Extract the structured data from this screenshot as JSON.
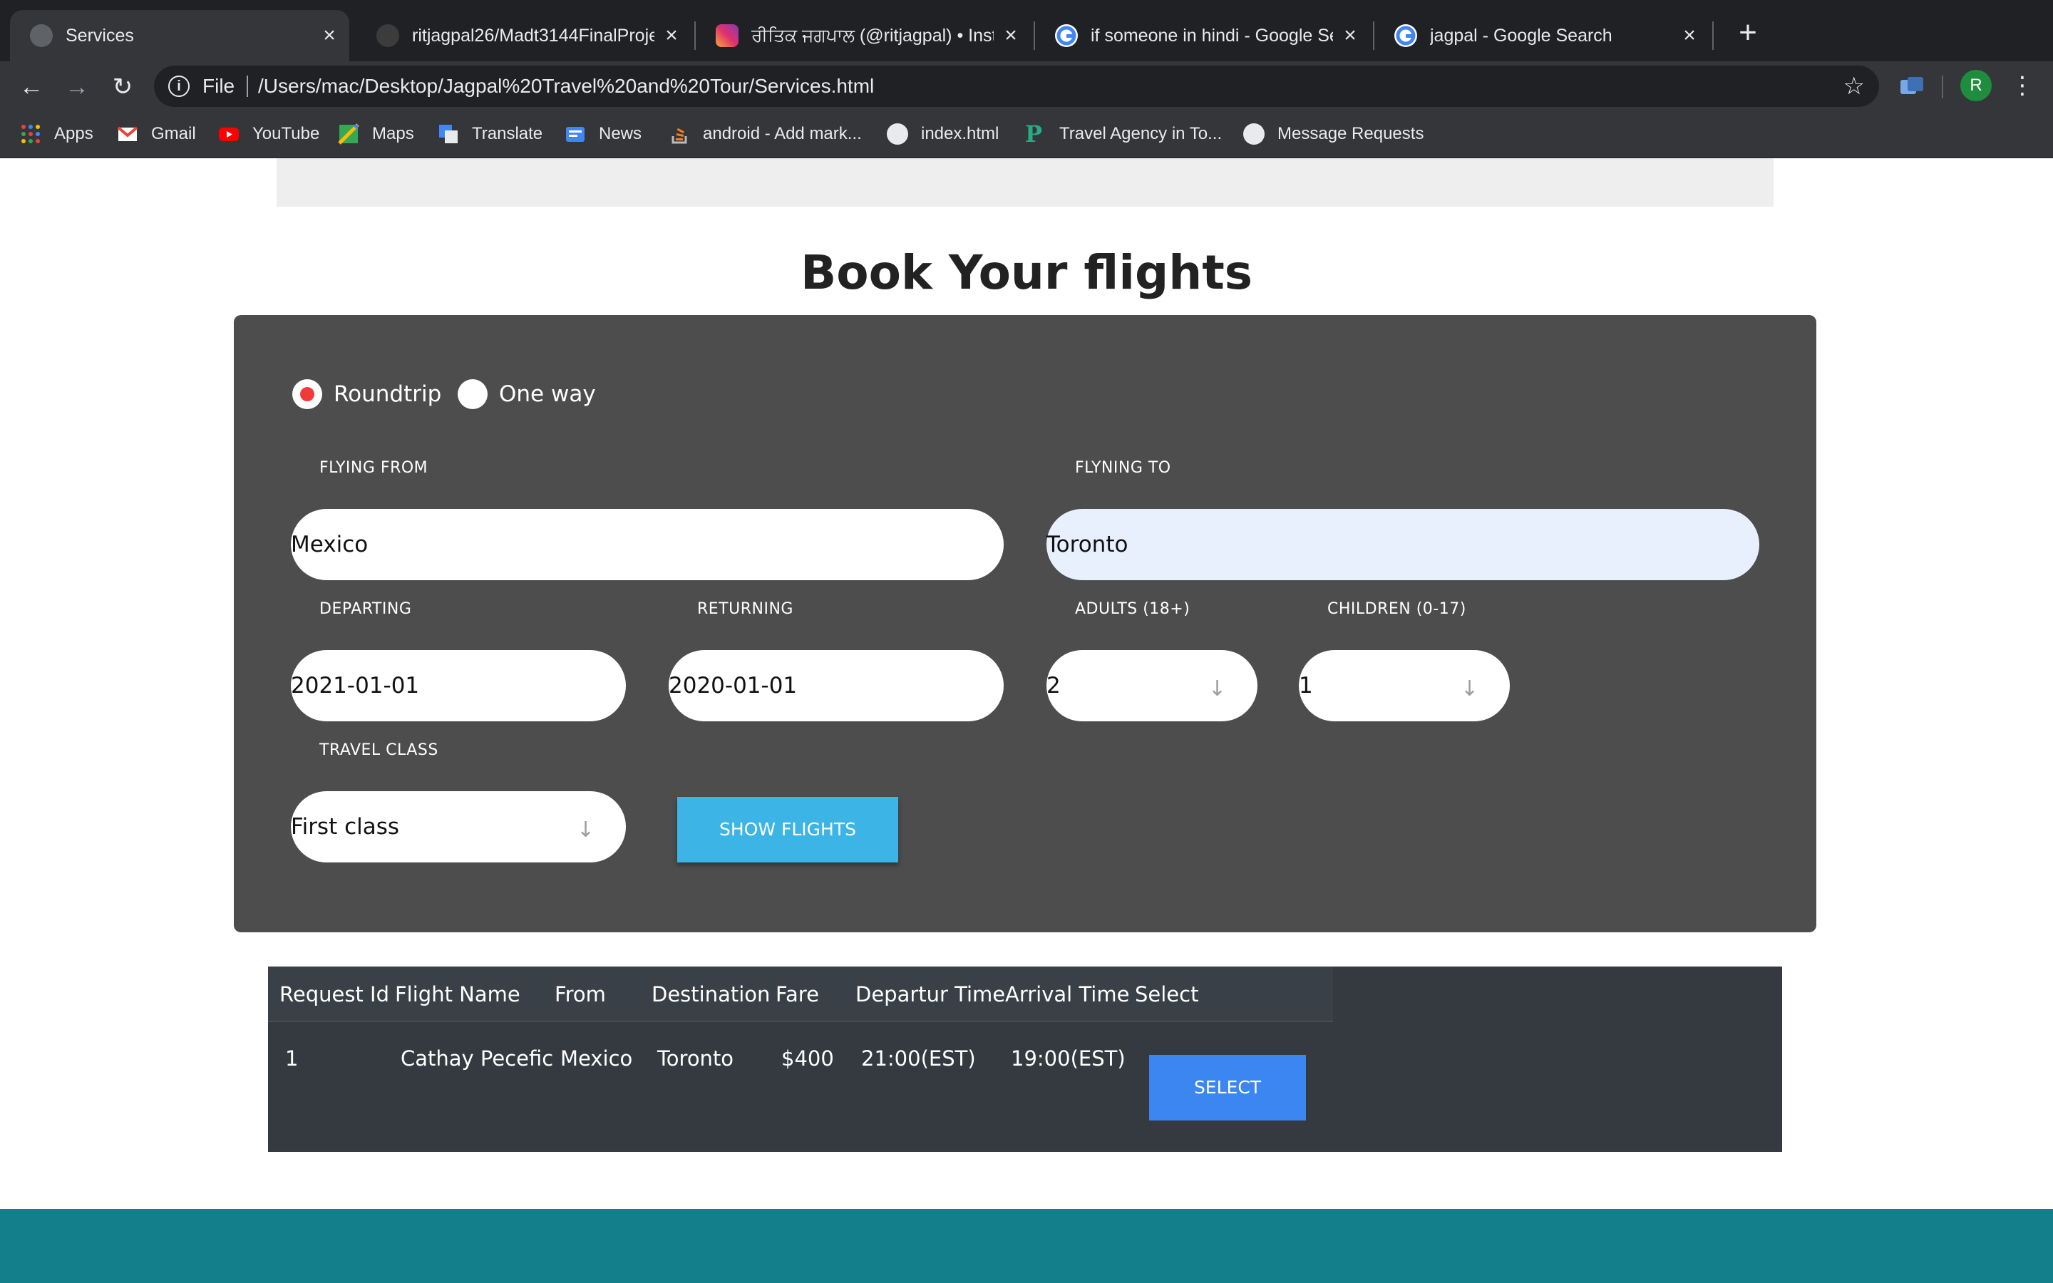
{
  "browser": {
    "tabs": [
      {
        "title": "Services",
        "icon": "globe-icon"
      },
      {
        "title": "ritjagpal26/Madt3144FinalProjec",
        "icon": "github-icon"
      },
      {
        "title": "ਰੀਤਿਕ ਜਗਪਾਲ (@ritjagpal) • Instagr",
        "icon": "instagram-icon"
      },
      {
        "title": "if someone in hindi - Google Sea",
        "icon": "google-icon"
      },
      {
        "title": "jagpal - Google Search",
        "icon": "google-icon"
      }
    ],
    "address": {
      "scheme": "File",
      "url": "/Users/mac/Desktop/Jagpal%20Travel%20and%20Tour/Services.html"
    },
    "profile_initial": "R",
    "bookmarks": [
      {
        "label": "Apps",
        "icon": "apps-grid-icon"
      },
      {
        "label": "Gmail",
        "icon": "gmail-icon"
      },
      {
        "label": "YouTube",
        "icon": "youtube-icon"
      },
      {
        "label": "Maps",
        "icon": "maps-icon"
      },
      {
        "label": "Translate",
        "icon": "translate-icon"
      },
      {
        "label": "News",
        "icon": "news-icon"
      },
      {
        "label": "android - Add mark...",
        "icon": "stackoverflow-icon"
      },
      {
        "label": "index.html",
        "icon": "globe-icon"
      },
      {
        "label": "Travel Agency in To...",
        "icon": "p-logo-icon"
      },
      {
        "label": "Message Requests",
        "icon": "globe-icon"
      }
    ]
  },
  "page": {
    "title": "Book Your flights",
    "trip_type": {
      "options": [
        "Roundtrip",
        "One way"
      ],
      "selected": "Roundtrip"
    },
    "form": {
      "flying_from_label": "FLYING FROM",
      "flying_from_value": "Mexico",
      "flying_to_label": "FLYNING TO",
      "flying_to_value": "Toronto",
      "departing_label": "DEPARTING",
      "departing_value": "2021-01-01",
      "returning_label": "RETURNING",
      "returning_value": "2020-01-01",
      "adults_label": "ADULTS (18+)",
      "adults_value": "2",
      "children_label": "CHILDREN (0-17)",
      "children_value": "1",
      "travel_class_label": "TRAVEL CLASS",
      "travel_class_value": "First class",
      "submit_label": "SHOW FLIGHTS"
    },
    "results": {
      "headers": [
        "Request Id",
        "Flight Name",
        "From",
        "Destination",
        "Fare",
        "Departur Time",
        "Arrival Time",
        "Select"
      ],
      "rows": [
        {
          "request_id": "1",
          "flight_name": "Cathay Pecefic",
          "from": "Mexico",
          "destination": "Toronto",
          "fare": "$400",
          "departure_time": "21:00(EST)",
          "arrival_time": "19:00(EST)",
          "select_label": "SELECT"
        }
      ]
    }
  },
  "colors": {
    "panel_bg": "#4d4d4d",
    "radio_selected": "#f23a3a",
    "show_button": "#3cb4e5",
    "select_button": "#3b86f0",
    "table_bg": "#343a40",
    "footer": "#127f8a"
  }
}
